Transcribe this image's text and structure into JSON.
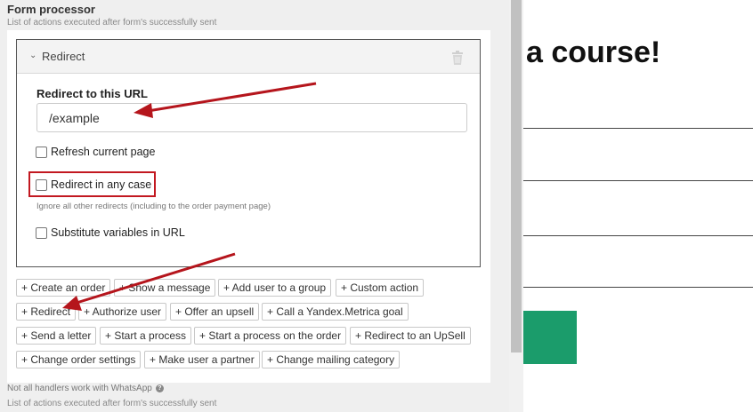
{
  "header": {
    "title": "Form processor",
    "subtitle": "List of actions executed after form's successfully sent"
  },
  "redirect_card": {
    "title": "Redirect",
    "url_label": "Redirect to this URL",
    "url_value": "/example",
    "checkbox_refresh": "Refresh current page",
    "checkbox_any_case": "Redirect in any case",
    "any_case_hint": "Ignore all other redirects (including to the order payment page)",
    "checkbox_substitute": "Substitute variables in URL"
  },
  "action_buttons": [
    [
      "+ Create an order",
      "+ Show a message",
      "+ Add user to a group",
      "+ Custom action"
    ],
    [
      "+ Redirect",
      "+ Authorize user",
      "+ Offer an upsell",
      "+ Call a Yandex.Metrica goal"
    ],
    [
      "+ Send a letter",
      "+ Start a process",
      "+ Start a process on the order",
      "+ Redirect to an UpSell"
    ],
    [
      "+ Change order settings",
      "+ Make user a partner",
      "+ Change mailing category"
    ]
  ],
  "footer": {
    "note": "Not all handlers work with WhatsApp",
    "subtitle": "List of actions executed after form's successfully sent"
  },
  "preview": {
    "heading": "a course!"
  },
  "colors": {
    "annotation_red": "#c21820",
    "preview_button_green": "#1b9c6b"
  }
}
